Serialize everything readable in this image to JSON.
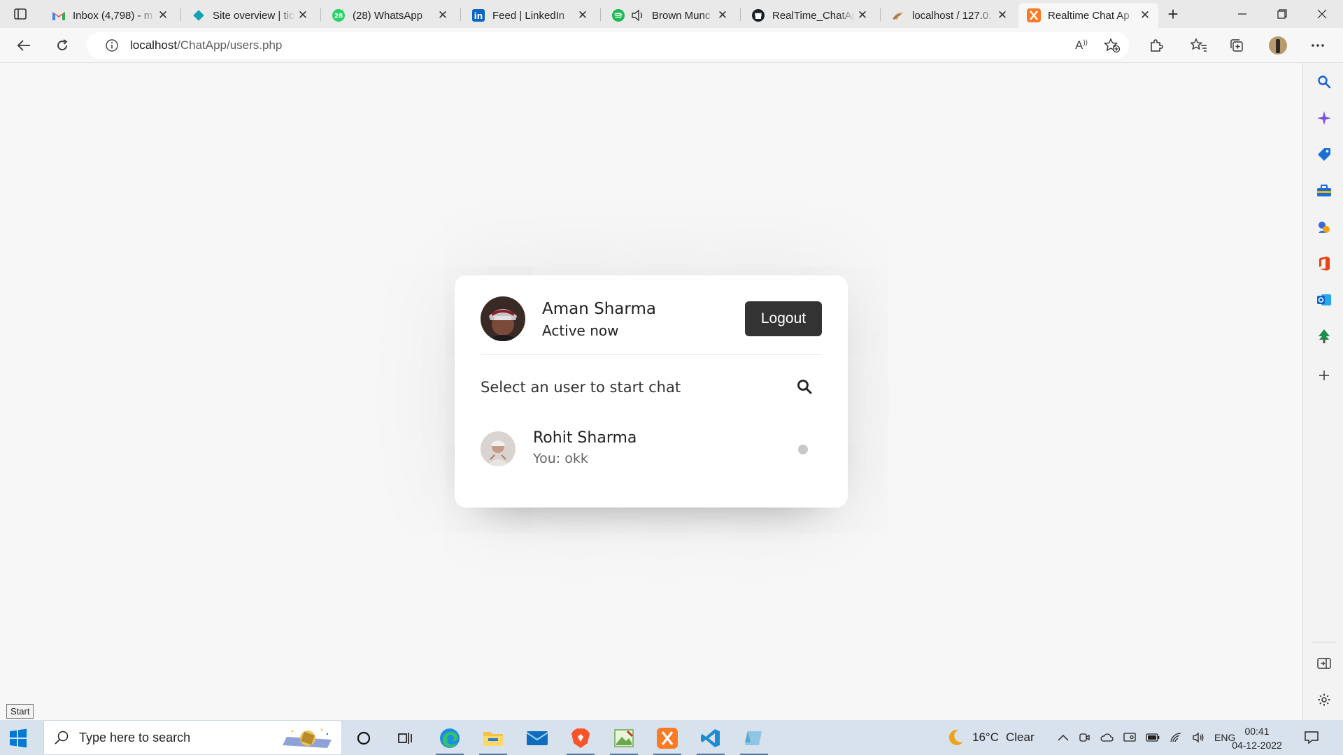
{
  "browser": {
    "tabs": [
      {
        "title": "Inbox (4,798) - m",
        "icon": "gmail-icon"
      },
      {
        "title": "Site overview | tic",
        "icon": "site-diamond-icon"
      },
      {
        "title": "(28) WhatsApp",
        "icon": "whatsapp-icon",
        "badge": "28"
      },
      {
        "title": "Feed | LinkedIn",
        "icon": "linkedin-icon"
      },
      {
        "title": "Brown Munc",
        "icon": "spotify-icon"
      },
      {
        "title": "RealTime_ChatAp",
        "icon": "github-icon"
      },
      {
        "title": "localhost / 127.0.",
        "icon": "phpmyadmin-icon"
      },
      {
        "title": "Realtime Chat Ap",
        "icon": "xampp-icon",
        "active": true
      }
    ],
    "url": {
      "host": "localhost",
      "path": "/ChatApp/users.php"
    },
    "zoom_readaloud_label": "A"
  },
  "chat": {
    "current_user": {
      "name": "Aman Sharma",
      "status": "Active now"
    },
    "logout_label": "Logout",
    "search_prompt": "Select an user to start chat",
    "users": [
      {
        "name": "Rohit Sharma",
        "last_message": "You: okk",
        "online": false
      }
    ]
  },
  "tooltip": {
    "start": "Start"
  },
  "taskbar": {
    "search_placeholder": "Type here to search",
    "weather": {
      "temp": "16°C",
      "condition": "Clear"
    },
    "language": "ENG",
    "time": "00:41",
    "date": "04-12-2022"
  },
  "colors": {
    "accent": "#333333",
    "offline_dot": "#c8c8c8"
  }
}
